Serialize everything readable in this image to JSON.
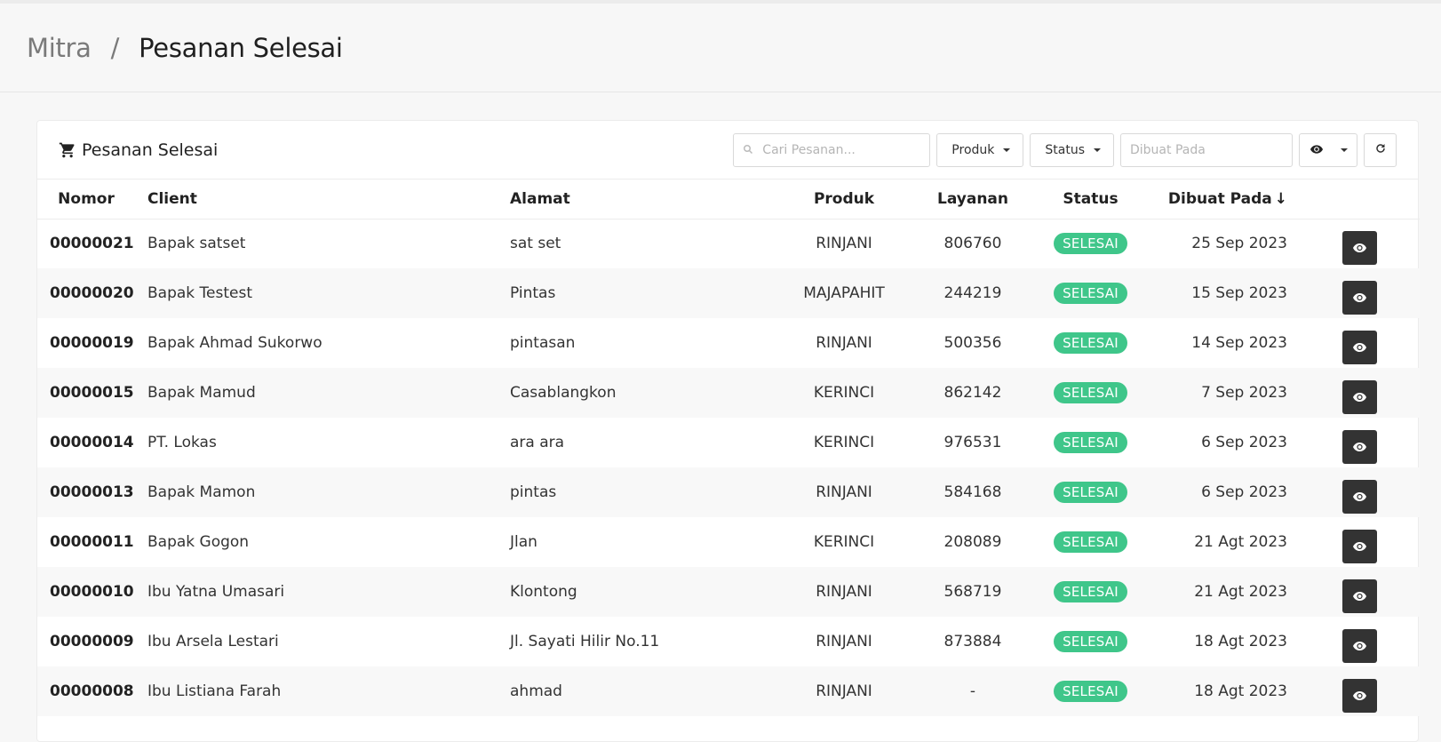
{
  "breadcrumb": {
    "root": "Mitra",
    "separator": "/",
    "current": "Pesanan Selesai"
  },
  "card": {
    "title": "Pesanan Selesai",
    "icon": "cart-icon",
    "search_placeholder": "Cari Pesanan...",
    "produk_label": "Produk",
    "status_label": "Status",
    "date_placeholder": "Dibuat Pada"
  },
  "table": {
    "headers": {
      "nomor": "Nomor",
      "client": "Client",
      "alamat": "Alamat",
      "produk": "Produk",
      "layanan": "Layanan",
      "status": "Status",
      "dibuat": "Dibuat Pada",
      "sort_indicator": "↓"
    },
    "rows": [
      {
        "nomor": "00000021",
        "client": "Bapak satset",
        "alamat": "sat set",
        "produk": "RINJANI",
        "layanan": "806760",
        "status": "SELESAI",
        "dibuat": "25 Sep 2023"
      },
      {
        "nomor": "00000020",
        "client": "Bapak Testest",
        "alamat": "Pintas",
        "produk": "MAJAPAHIT",
        "layanan": "244219",
        "status": "SELESAI",
        "dibuat": "15 Sep 2023"
      },
      {
        "nomor": "00000019",
        "client": "Bapak Ahmad Sukorwo",
        "alamat": "pintasan",
        "produk": "RINJANI",
        "layanan": "500356",
        "status": "SELESAI",
        "dibuat": "14 Sep 2023"
      },
      {
        "nomor": "00000015",
        "client": "Bapak Mamud",
        "alamat": "Casablangkon",
        "produk": "KERINCI",
        "layanan": "862142",
        "status": "SELESAI",
        "dibuat": "7 Sep 2023"
      },
      {
        "nomor": "00000014",
        "client": "PT. Lokas",
        "alamat": "ara ara",
        "produk": "KERINCI",
        "layanan": "976531",
        "status": "SELESAI",
        "dibuat": "6 Sep 2023"
      },
      {
        "nomor": "00000013",
        "client": "Bapak Mamon",
        "alamat": "pintas",
        "produk": "RINJANI",
        "layanan": "584168",
        "status": "SELESAI",
        "dibuat": "6 Sep 2023"
      },
      {
        "nomor": "00000011",
        "client": "Bapak Gogon",
        "alamat": "Jlan",
        "produk": "KERINCI",
        "layanan": "208089",
        "status": "SELESAI",
        "dibuat": "21 Agt 2023"
      },
      {
        "nomor": "00000010",
        "client": "Ibu Yatna Umasari",
        "alamat": "Klontong",
        "produk": "RINJANI",
        "layanan": "568719",
        "status": "SELESAI",
        "dibuat": "21 Agt 2023"
      },
      {
        "nomor": "00000009",
        "client": "Ibu Arsela Lestari",
        "alamat": "Jl. Sayati Hilir No.11",
        "produk": "RINJANI",
        "layanan": "873884",
        "status": "SELESAI",
        "dibuat": "18 Agt 2023"
      },
      {
        "nomor": "00000008",
        "client": "Ibu Listiana Farah",
        "alamat": "ahmad",
        "produk": "RINJANI",
        "layanan": "-",
        "status": "SELESAI",
        "dibuat": "18 Agt 2023"
      }
    ]
  },
  "colors": {
    "badge": "#3fc68a",
    "action_button": "#333333"
  }
}
